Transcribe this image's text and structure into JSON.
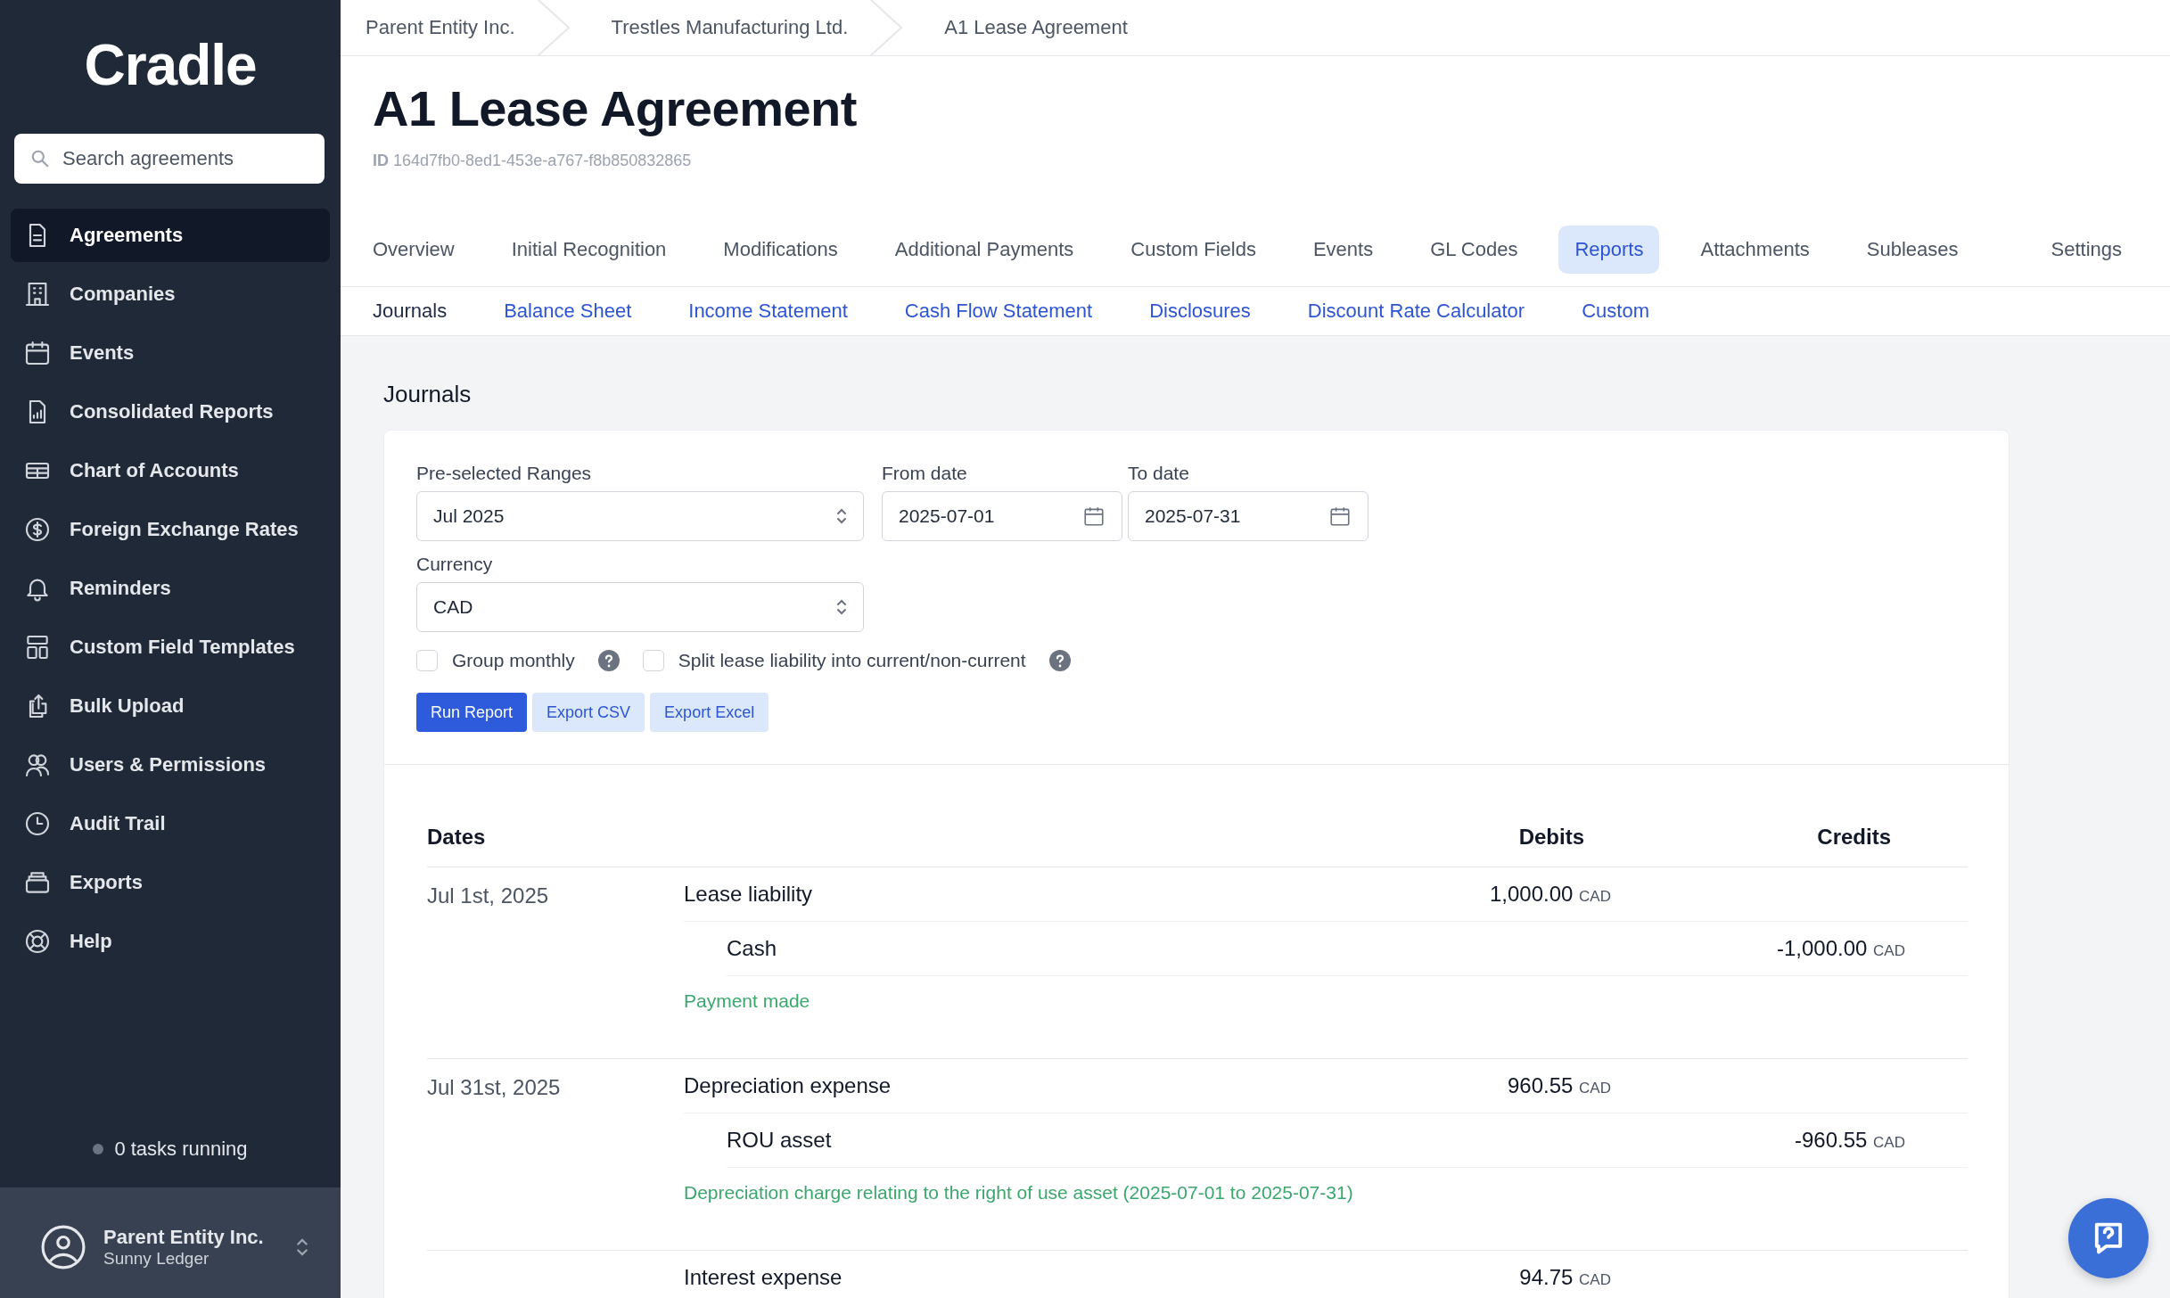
{
  "sidebar": {
    "logo": "Cradle",
    "search": {
      "placeholder": "Search agreements"
    },
    "items": [
      {
        "label": "Agreements",
        "kind": "document",
        "selected": true
      },
      {
        "label": "Companies",
        "kind": "building",
        "selected": false
      },
      {
        "label": "Events",
        "kind": "calendar",
        "selected": false
      },
      {
        "label": "Consolidated Reports",
        "kind": "report",
        "selected": false
      },
      {
        "label": "Chart of Accounts",
        "kind": "table",
        "selected": false
      },
      {
        "label": "Foreign Exchange Rates",
        "kind": "dollar",
        "selected": false
      },
      {
        "label": "Reminders",
        "kind": "bell",
        "selected": false
      },
      {
        "label": "Custom Field Templates",
        "kind": "layout",
        "selected": false
      },
      {
        "label": "Bulk Upload",
        "kind": "upload",
        "selected": false
      },
      {
        "label": "Users & Permissions",
        "kind": "users",
        "selected": false
      },
      {
        "label": "Audit Trail",
        "kind": "clock",
        "selected": false
      },
      {
        "label": "Exports",
        "kind": "archive",
        "selected": false
      },
      {
        "label": "Help",
        "kind": "lifebuoy",
        "selected": false
      }
    ],
    "tasks": "0 tasks running",
    "account": {
      "name": "Parent Entity Inc.",
      "subtitle": "Sunny Ledger"
    }
  },
  "breadcrumbs": [
    "Parent Entity Inc.",
    "Trestles Manufacturing Ltd.",
    "A1 Lease Agreement"
  ],
  "title": "A1 Lease Agreement",
  "id_label": "ID",
  "id": "164d7fb0-8ed1-453e-a767-f8b850832865",
  "tabs": [
    {
      "label": "Overview",
      "selected": false
    },
    {
      "label": "Initial Recognition",
      "selected": false
    },
    {
      "label": "Modifications",
      "selected": false
    },
    {
      "label": "Additional Payments",
      "selected": false
    },
    {
      "label": "Custom Fields",
      "selected": false
    },
    {
      "label": "Events",
      "selected": false
    },
    {
      "label": "GL Codes",
      "selected": false
    },
    {
      "label": "Reports",
      "selected": true
    },
    {
      "label": "Attachments",
      "selected": false
    },
    {
      "label": "Subleases",
      "selected": false
    },
    {
      "label": "Settings",
      "selected": false
    }
  ],
  "subtabs": [
    {
      "label": "Journals",
      "selected": true
    },
    {
      "label": "Balance Sheet",
      "selected": false
    },
    {
      "label": "Income Statement",
      "selected": false
    },
    {
      "label": "Cash Flow Statement",
      "selected": false
    },
    {
      "label": "Disclosures",
      "selected": false
    },
    {
      "label": "Discount Rate Calculator",
      "selected": false
    },
    {
      "label": "Custom",
      "selected": false
    }
  ],
  "section_title": "Journals",
  "form": {
    "range": {
      "label": "Pre-selected Ranges",
      "value": "Jul 2025"
    },
    "from": {
      "label": "From date",
      "value": "2025-07-01"
    },
    "to": {
      "label": "To date",
      "value": "2025-07-31"
    },
    "currency": {
      "label": "Currency",
      "value": "CAD"
    },
    "options": [
      {
        "label": "Group monthly",
        "checked": false
      },
      {
        "label": "Split lease liability into current/non-current",
        "checked": false
      }
    ],
    "buttons": [
      {
        "label": "Run Report",
        "kind": "primary"
      },
      {
        "label": "Export CSV",
        "kind": "secondary"
      },
      {
        "label": "Export Excel",
        "kind": "secondary"
      }
    ]
  },
  "journal": {
    "columns": [
      "Dates",
      "Debits",
      "Credits"
    ],
    "entries": [
      {
        "date": "Jul 1st, 2025",
        "lines": [
          {
            "account": "Lease liability",
            "kind": "debit",
            "amount": "1,000.00",
            "currency": "CAD"
          },
          {
            "account": "Cash",
            "kind": "credit",
            "amount": "-1,000.00",
            "currency": "CAD"
          }
        ],
        "description": "Payment made"
      },
      {
        "date": "Jul 31st, 2025",
        "lines": [
          {
            "account": "Depreciation expense",
            "kind": "debit",
            "amount": "960.55",
            "currency": "CAD"
          },
          {
            "account": "ROU asset",
            "kind": "credit",
            "amount": "-960.55",
            "currency": "CAD"
          }
        ],
        "description": "Depreciation charge relating to the right of use asset (2025-07-01 to 2025-07-31)"
      },
      {
        "lines": [
          {
            "account": "Interest expense",
            "kind": "debit",
            "amount": "94.75",
            "currency": "CAD"
          }
        ]
      }
    ]
  }
}
